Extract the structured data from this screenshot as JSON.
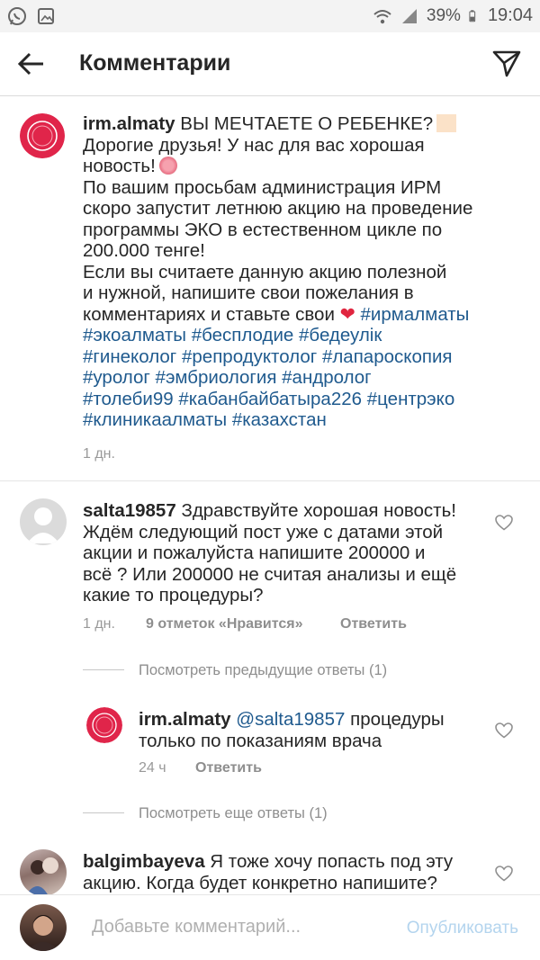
{
  "status_bar": {
    "battery": "39%",
    "time": "19:04"
  },
  "header": {
    "title": "Комментарии"
  },
  "post": {
    "username": "irm.almaty",
    "line1": "ВЫ МЕЧТАЕТЕ О РЕБЕНКЕ?",
    "line2": "Дорогие друзья! У нас для вас хорошая",
    "line3": "новость!",
    "line4": "По вашим просьбам администрация ИРМ",
    "line5": "скоро запустит летнюю акцию на проведение",
    "line6": "программы ЭКО в естественном цикле по",
    "line7": "200.000 тенге!",
    "line8": "Если вы считаете данную акцию полезной",
    "line9": "и нужной, напишите свои пожелания в",
    "line10": "комментариях и ставьте свои",
    "hashtags": [
      "#ирмалматы",
      "#экоалматы",
      "#бесплодие",
      "#бедеулік",
      "#гинеколог",
      "#репродуктолог",
      "#лапароскопия",
      "#уролог",
      "#эмбриология",
      "#андролог",
      "#толеби99",
      "#кабанбайбатыра226",
      "#центрэко",
      "#клиникаалматы",
      "#казахстан"
    ],
    "time": "1 дн."
  },
  "comment1": {
    "username": "salta19857",
    "line1": "Здравствуйте хорошая новость!",
    "line2": "Ждём следующий пост уже с датами этой",
    "line3": "акции и пожалуйста напишите 200000 и",
    "line4": "всё ? Или 200000 не считая анализы и ещё",
    "line5": "какие то процедуры?",
    "time": "1 дн.",
    "likes": "9 отметок «Нравится»",
    "reply": "Ответить"
  },
  "view_previous": "Посмотреть предыдущие ответы (1)",
  "reply1": {
    "username": "irm.almaty",
    "mention": "@salta19857",
    "line1": "процедуры",
    "line2": "только по показаниям врача",
    "time": "24 ч",
    "reply": "Ответить"
  },
  "view_more": "Посмотреть еще ответы (1)",
  "comment2": {
    "username": "balgimbayeva",
    "line1": "Я тоже хочу попасть под эту",
    "line2": "акцию. Когда будет конкретно напишите?"
  },
  "composer": {
    "placeholder": "Добавьте комментарий...",
    "publish": "Опубликовать"
  },
  "colors": {
    "hashtag": "#1f5a8e",
    "brand_red": "#e0254a",
    "publish_disabled": "#b3d4ee"
  }
}
